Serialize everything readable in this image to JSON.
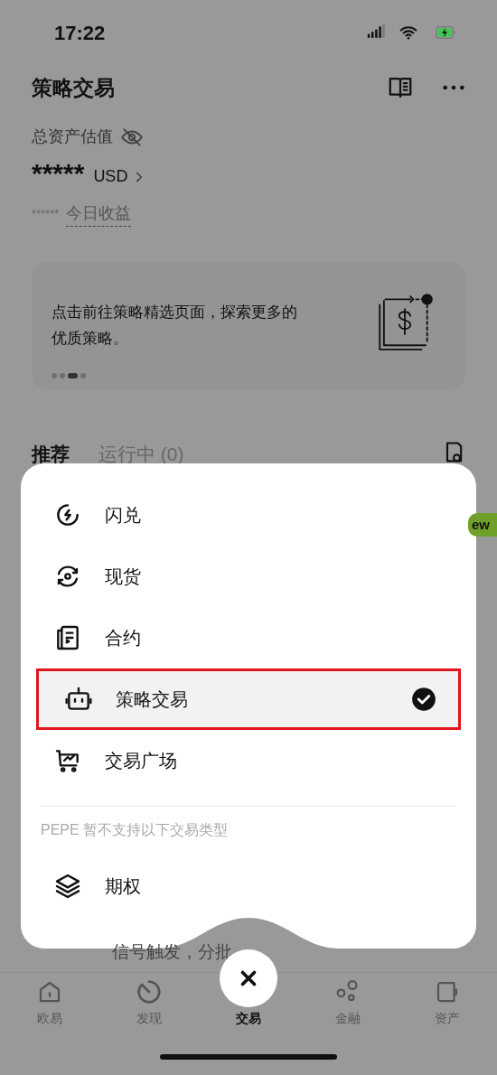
{
  "status_bar": {
    "time": "17:22"
  },
  "header": {
    "title": "策略交易"
  },
  "assets": {
    "label": "总资产估值",
    "value": "*****",
    "currency": "USD",
    "today_value": "******",
    "today_label": "今日收益"
  },
  "banner": {
    "text": "点击前往策略精选页面，探索更多的优质策略。",
    "pages": [
      {
        "selected": false
      },
      {
        "selected": false
      },
      {
        "selected": true
      },
      {
        "selected": false
      }
    ]
  },
  "tabs": [
    {
      "label": "推荐",
      "selected": true
    },
    {
      "label": "运行中 (0)",
      "selected": false
    }
  ],
  "badge": "ew",
  "background_text": "信号触发，分批",
  "sheet": {
    "items": [
      {
        "label": "闪兑",
        "kind": "flash",
        "selected": false
      },
      {
        "label": "现货",
        "kind": "spot",
        "selected": false
      },
      {
        "label": "合约",
        "kind": "contract",
        "selected": false
      },
      {
        "label": "策略交易",
        "kind": "bot",
        "selected": true
      },
      {
        "label": "交易广场",
        "kind": "square",
        "selected": false
      }
    ],
    "note": "PEPE 暂不支持以下交易类型",
    "unsupported": [
      {
        "label": "期权",
        "kind": "layers"
      }
    ]
  },
  "bottom_nav": [
    {
      "label": "欧易",
      "kind": "home",
      "selected": false
    },
    {
      "label": "发现",
      "kind": "discover",
      "selected": false
    },
    {
      "label": "交易",
      "kind": "close",
      "selected": true
    },
    {
      "label": "金融",
      "kind": "finance",
      "selected": false
    },
    {
      "label": "资产",
      "kind": "wallet",
      "selected": false
    }
  ]
}
